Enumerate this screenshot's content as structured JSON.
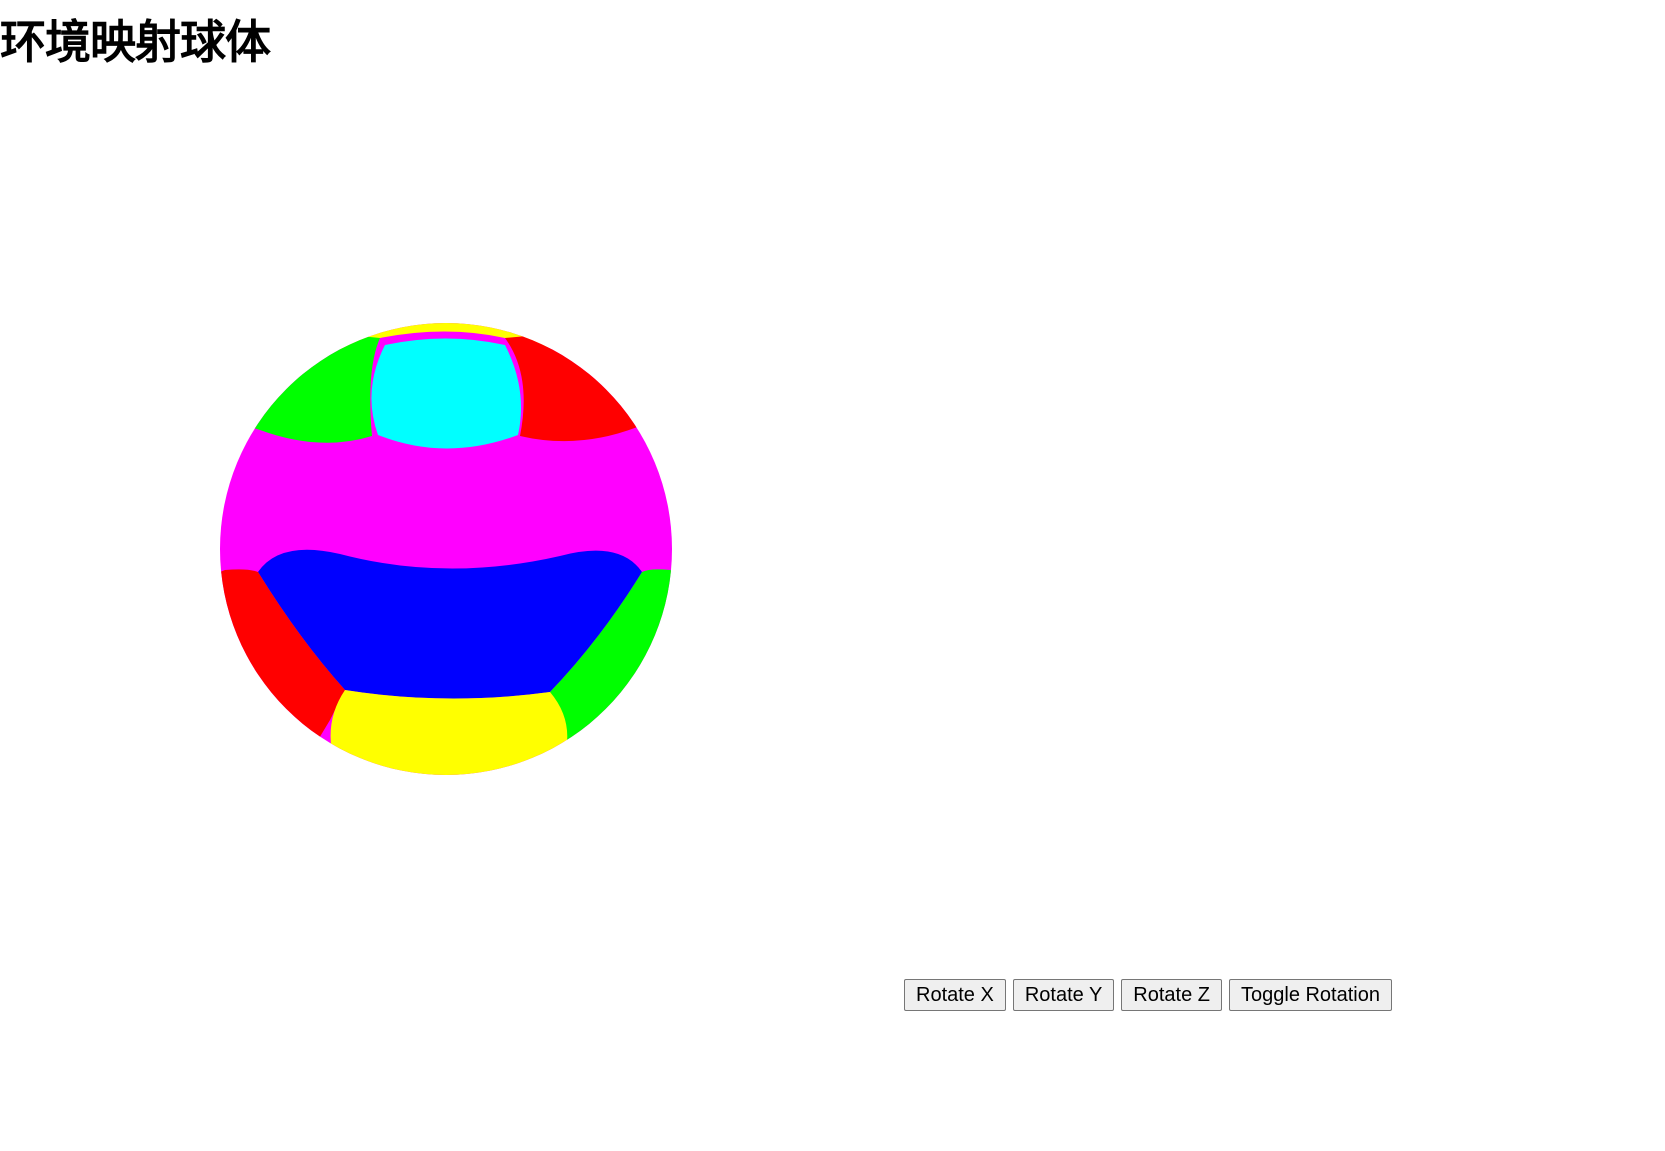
{
  "page": {
    "title": "环境映射球体"
  },
  "sphere": {
    "colors": {
      "top_cap": "#00ffff",
      "top_rim": "#ffff00",
      "upper_left": "#00ff00",
      "upper_right": "#ff0000",
      "equator_band": "#ff00ff",
      "lower_band": "#0000ff",
      "lower_left": "#ff0000",
      "lower_right": "#00ff00",
      "bottom_cap": "#ffff00"
    }
  },
  "controls": {
    "rotate_x": "Rotate X",
    "rotate_y": "Rotate Y",
    "rotate_z": "Rotate Z",
    "toggle_rotation": "Toggle Rotation"
  }
}
